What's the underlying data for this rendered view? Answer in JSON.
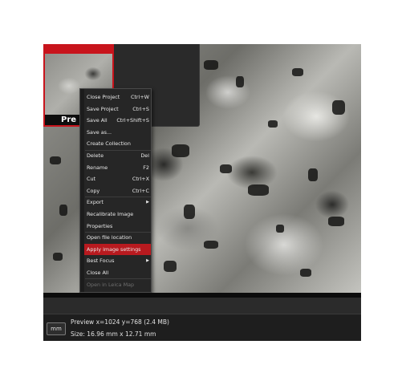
{
  "thumbnail": {
    "label": "Pre"
  },
  "context_menu": {
    "items": [
      {
        "label": "Close Project",
        "shortcut": "Ctrl+W"
      },
      {
        "label": "Save Project",
        "shortcut": "Ctrl+S"
      },
      {
        "label": "Save All",
        "shortcut": "Ctrl+Shift+S"
      },
      {
        "label": "Save as...",
        "shortcut": ""
      },
      {
        "label": "Create Collection",
        "shortcut": ""
      },
      {
        "label": "Delete",
        "shortcut": "Del"
      },
      {
        "label": "Rename",
        "shortcut": "F2"
      },
      {
        "label": "Cut",
        "shortcut": "Ctrl+X"
      },
      {
        "label": "Copy",
        "shortcut": "Ctrl+C"
      },
      {
        "label": "Export",
        "shortcut": ""
      },
      {
        "label": "Recalibrate Image",
        "shortcut": ""
      },
      {
        "label": "Properties",
        "shortcut": ""
      },
      {
        "label": "Open file location",
        "shortcut": ""
      },
      {
        "label": "Apply image settings",
        "shortcut": ""
      },
      {
        "label": "Best Focus",
        "shortcut": ""
      },
      {
        "label": "Close All",
        "shortcut": ""
      },
      {
        "label": "Open in Leica Map",
        "shortcut": ""
      }
    ],
    "selected_item": "Apply image settings",
    "disabled_item": "Open in Leica Map",
    "submenu_items": [
      "Export",
      "Best Focus"
    ]
  },
  "status_bar": {
    "unit_button": "mm",
    "preview_text": "Preview x=1024 y=768  (2.4 MB)",
    "size_text": "Size: 16.96 mm x 12.71 mm"
  },
  "colors": {
    "accent": "#c8141c",
    "menu_bg": "#262626",
    "selected": "#b81a1f"
  },
  "icons": {
    "submenu": "chevron-right-icon"
  }
}
